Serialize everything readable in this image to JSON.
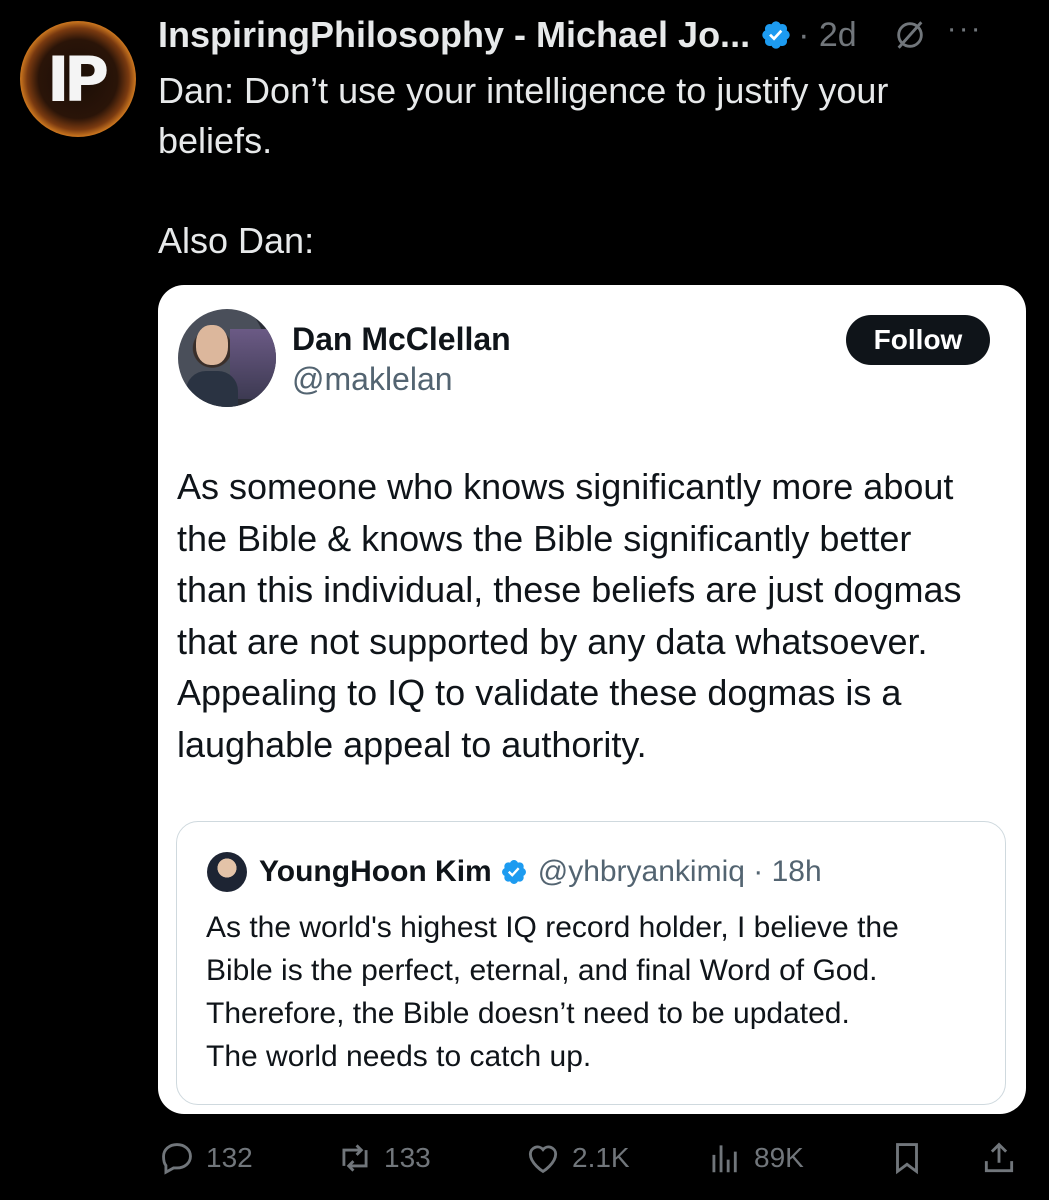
{
  "tweet": {
    "author_name": "InspiringPhilosophy - Michael Jo...",
    "avatar_text": "IP",
    "meta": "· 2d",
    "more_label": "···",
    "text": "Dan: Don’t use your intelligence to justify your\nbeliefs.\n\nAlso Dan:"
  },
  "quoted": {
    "name": "Dan McClellan",
    "handle": "@maklelan",
    "follow_label": "Follow",
    "text": "As someone who knows significantly more about\nthe Bible & knows the Bible significantly better\nthan this individual, these beliefs are just dogmas\nthat are not supported by any data whatsoever.\nAppealing to IQ to validate these dogmas is a\nlaughable appeal to authority."
  },
  "inner_quote": {
    "name": "YoungHoon Kim",
    "handle_time": "@yhbryankimiq · 18h",
    "text": "As the world's highest IQ record holder, I believe the\nBible is the perfect, eternal, and final Word of God.\nTherefore, the Bible doesn’t need to be updated.\nThe world needs to catch up."
  },
  "actions": {
    "replies": "132",
    "reposts": "133",
    "likes": "2.1K",
    "views": "89K"
  },
  "colors": {
    "background": "#000000",
    "verified": "#1d9bf0",
    "muted": "#71767b"
  }
}
